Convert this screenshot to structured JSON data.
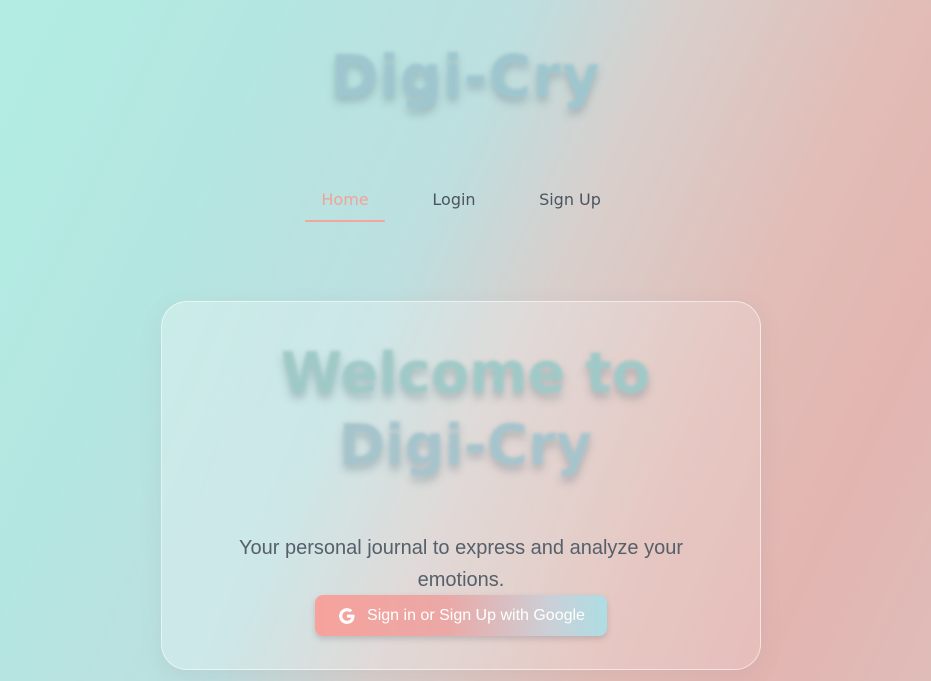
{
  "header": {
    "title": "Digi-Cry"
  },
  "nav": {
    "items": [
      {
        "label": "Home",
        "active": true
      },
      {
        "label": "Login",
        "active": false
      },
      {
        "label": "Sign Up",
        "active": false
      }
    ]
  },
  "hero": {
    "title_line1": "Welcome to",
    "title_line2": "Digi-Cry",
    "tagline": "Your personal journal to express and analyze your emotions.",
    "google_button_label": "Sign in or Sign Up with Google",
    "google_button_icon": "google-g-icon"
  },
  "colors": {
    "accent": "#f2a69c",
    "nav_text": "#4b5560",
    "button_gradient_start": "#f7a29c",
    "button_gradient_end": "#aedde4"
  }
}
